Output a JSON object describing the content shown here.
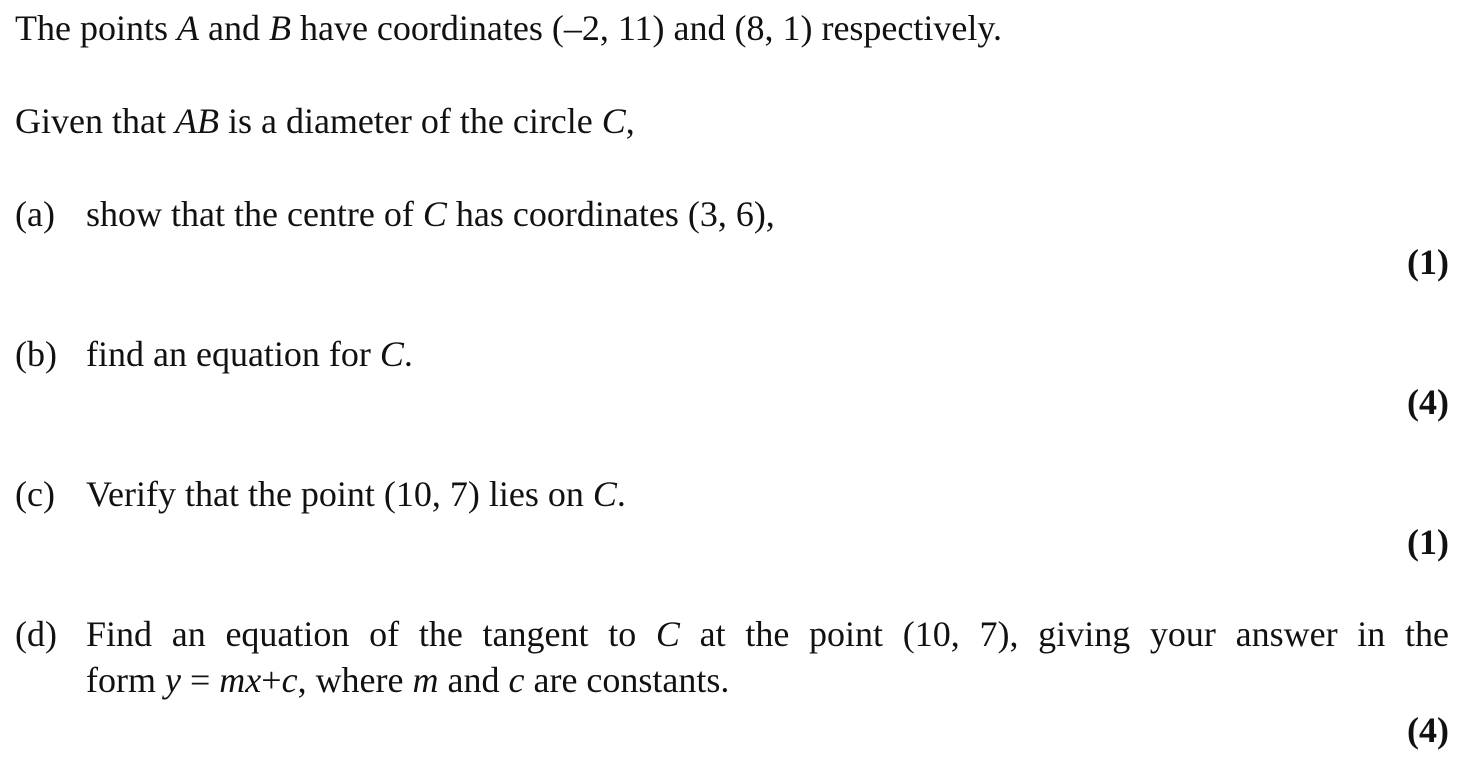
{
  "intro": {
    "line1": {
      "pre": "The points ",
      "v1": "A",
      "mid": " and ",
      "v2": "B",
      "post": " have coordinates (–2, 11) and (8, 1) respectively."
    },
    "line2": {
      "pre": "Given that ",
      "v1": "AB",
      "mid": " is a diameter of the circle ",
      "v2": "C",
      "post": ","
    }
  },
  "parts": [
    {
      "label": "(a)",
      "pre": "show that the centre of ",
      "var": "C",
      "post": " has coordinates (3, 6),",
      "marks": "(1)"
    },
    {
      "label": "(b)",
      "pre": "find an equation for ",
      "var": "C",
      "post": ".",
      "marks": "(4)"
    },
    {
      "label": "(c)",
      "pre": "Verify that the point (10, 7) lies on ",
      "var": "C",
      "post": ".",
      "marks": "(1)"
    },
    {
      "label": "(d)",
      "line1_pre": "Find an equation of the tangent to ",
      "line1_var": "C",
      "line1_post": " at the point (10, 7), giving your answer in the",
      "line2_a": "form ",
      "line2_y": "y",
      "line2_eq": " = ",
      "line2_mx": "mx",
      "line2_plus": "+",
      "line2_c": "c",
      "line2_b": ", where ",
      "line2_m": "m",
      "line2_and": " and ",
      "line2_c2": "c",
      "line2_end": " are constants.",
      "marks": "(4)"
    }
  ]
}
